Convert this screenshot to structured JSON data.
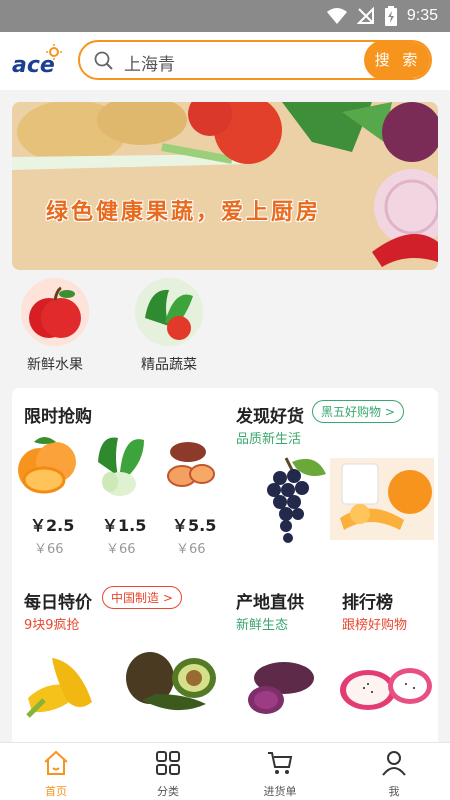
{
  "status_bar": {
    "time": "9:35"
  },
  "header": {
    "logo_text": "ace",
    "search_placeholder": "上海青",
    "search_button": "搜 索"
  },
  "banner": {
    "text": "绿色健康果蔬，爱上厨房"
  },
  "categories": [
    {
      "label": "新鲜水果",
      "icon": "apple-icon"
    },
    {
      "label": "精品蔬菜",
      "icon": "vegetable-icon"
    }
  ],
  "flash_sale": {
    "title": "限时抢购",
    "items": [
      {
        "price": "￥2.5",
        "old_price": "￥66"
      },
      {
        "price": "￥1.5",
        "old_price": "￥66"
      },
      {
        "price": "￥5.5",
        "old_price": "￥66"
      }
    ]
  },
  "discover": {
    "title": "发现好货",
    "badge": "黑五好购物 >",
    "subtitle": "品质新生活"
  },
  "daily": {
    "title": "每日特价",
    "badge": "中国制造 >",
    "subtitle": "9块9疯抢"
  },
  "origin": {
    "title": "产地直供",
    "subtitle": "新鲜生态"
  },
  "ranking": {
    "title": "排行榜",
    "subtitle": "跟榜好购物"
  },
  "tabs": [
    {
      "label": "首页",
      "active": true
    },
    {
      "label": "分类",
      "active": false
    },
    {
      "label": "进货单",
      "active": false
    },
    {
      "label": "我",
      "active": false
    }
  ],
  "colors": {
    "accent": "#f7941d",
    "green": "#3aa76d",
    "red": "#e8472f"
  }
}
